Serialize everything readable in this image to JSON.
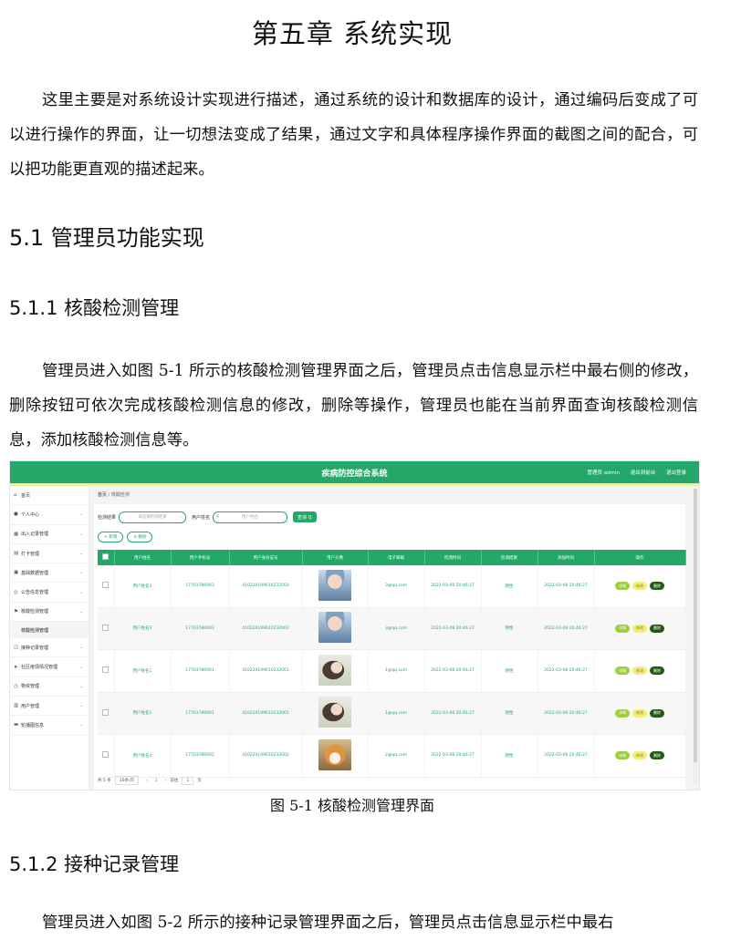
{
  "chapter_title": "第五章  系统实现",
  "intro_text": "这里主要是对系统设计实现进行描述，通过系统的设计和数据库的设计，通过编码后变成了可以进行操作的界面，让一切想法变成了结果，通过文字和具体程序操作界面的截图之间的配合，可以把功能更直观的描述起来。",
  "section_5_1": "5.1 管理员功能实现",
  "section_5_1_1": "5.1.1  核酸检测管理",
  "para_5_1_1": "管理员进入如图 5-1 所示的核酸检测管理界面之后，管理员点击信息显示栏中最右侧的修改，删除按钮可依次完成核酸检测信息的修改，删除等操作，管理员也能在当前界面查询核酸检测信息，添加核酸检测信息等。",
  "figure_caption": "图 5-1  核酸检测管理界面",
  "section_5_1_2": "5.1.2  接种记录管理",
  "para_5_1_2_partial": "管理员进入如图 5-2 所示的接种记录管理界面之后，管理员点击信息显示栏中最右",
  "app": {
    "title": "疾病防控综合系统",
    "top_links": [
      "管理员 admin",
      "退出到前台",
      "退出登录"
    ],
    "breadcrumb_home": "首页",
    "breadcrumb_sep": "/",
    "breadcrumb_current": "核酸检测",
    "sidebar": [
      {
        "icon": "home-icon",
        "glyph": "⌂",
        "label": "首页",
        "chevron": false
      },
      {
        "icon": "user-icon",
        "glyph": "●",
        "label": "个人中心",
        "chevron": true
      },
      {
        "icon": "building-icon",
        "glyph": "▦",
        "label": "出入记录管理",
        "chevron": true
      },
      {
        "icon": "grid-icon",
        "glyph": "▤",
        "label": "打卡管理",
        "chevron": true
      },
      {
        "icon": "doc-icon",
        "glyph": "▣",
        "label": "基础数据管理",
        "chevron": true
      },
      {
        "icon": "notice-icon",
        "glyph": "◎",
        "label": "公告信息管理",
        "chevron": true
      },
      {
        "icon": "flag-icon",
        "glyph": "⚑",
        "label": "核酸检测管理",
        "chevron": true
      },
      {
        "icon": "record-icon",
        "glyph": "◫",
        "label": "接种记录管理",
        "chevron": true
      },
      {
        "icon": "send-icon",
        "glyph": "➤",
        "label": "社区疫情情况管理",
        "chevron": true
      },
      {
        "icon": "clock-icon",
        "glyph": "◷",
        "label": "物资管理",
        "chevron": true
      },
      {
        "icon": "chart-icon",
        "glyph": "▥",
        "label": "用户管理",
        "chevron": true
      },
      {
        "icon": "chat-icon",
        "glyph": "▬",
        "label": "轮播图信息",
        "chevron": true
      }
    ],
    "sidebar_sub_item": "核酸检测管理",
    "filter_result_label": "检测结果",
    "filter_result_placeholder": "请选择检测结果",
    "filter_name_label": "用户姓名",
    "filter_name_placeholder": "用户姓名",
    "search_button": "查询 Q",
    "add_button": "+ 新增",
    "delete_button": "⊖ 删除",
    "columns": [
      "",
      "用户姓名",
      "用户手机号",
      "用户身份证号",
      "用户头像",
      "电子邮箱",
      "检测时间",
      "检测结果",
      "添加时间",
      "操作"
    ],
    "rows": [
      {
        "name": "用户姓名3",
        "phone": "17703786903",
        "idno": "410224199610232003",
        "avatar": "avatar-boy",
        "email": "3@qq.com",
        "test_time": "2022-03-08 20:46:27",
        "result": "阴性",
        "added": "2022-03-08 20:46:27"
      },
      {
        "name": "用户姓名3",
        "phone": "17703786903",
        "idno": "410224199610232003",
        "avatar": "avatar-boy",
        "email": "3@qq.com",
        "test_time": "2022-03-08 20:46:27",
        "result": "阴性",
        "added": "2022-03-08 20:46:27"
      },
      {
        "name": "用户姓名1",
        "phone": "17703786901",
        "idno": "410224199610232001",
        "avatar": "avatar-girl",
        "email": "1@qq.com",
        "test_time": "2022-03-08 20:46:27",
        "result": "阴性",
        "added": "2022-03-08 20:46:27"
      },
      {
        "name": "用户姓名1",
        "phone": "17703786901",
        "idno": "410224199610232001",
        "avatar": "avatar-girl",
        "email": "1@qq.com",
        "test_time": "2022-03-08 20:46:27",
        "result": "阴性",
        "added": "2022-03-08 20:46:27"
      },
      {
        "name": "用户姓名2",
        "phone": "17703786902",
        "idno": "410224199610232002",
        "avatar": "avatar-dog",
        "email": "2@qq.com",
        "test_time": "2022-03-08 20:46:27",
        "result": "阴性",
        "added": "2022-03-08 20:46:27"
      }
    ],
    "op_detail": "详情",
    "op_edit": "修改",
    "op_delete": "删除",
    "pager_total": "共 5 条",
    "pager_size": "10条/页",
    "pager_prev": "‹",
    "pager_current": "1",
    "pager_next": "›",
    "pager_goto": "前往",
    "pager_goto_value": "1",
    "pager_page_unit": "页",
    "colors": {
      "primary": "#23a86a",
      "accent_bar": "#e8f4a8",
      "detail": "#9ccf3c",
      "edit": "#f3f06d",
      "delete": "#235a12"
    }
  }
}
